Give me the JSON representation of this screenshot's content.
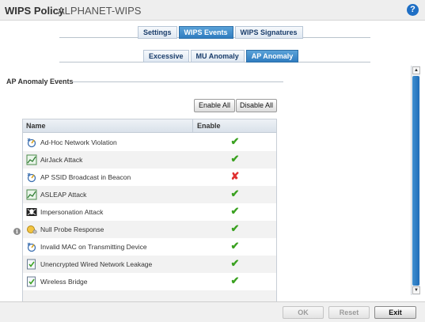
{
  "header": {
    "title": "WIPS Policy",
    "subtitle": "ALPHANET-WIPS",
    "help_icon": "help-icon"
  },
  "tabs_main": [
    {
      "label": "Settings",
      "active": false
    },
    {
      "label": "WIPS Events",
      "active": true
    },
    {
      "label": "WIPS Signatures",
      "active": false
    }
  ],
  "tabs_sub": [
    {
      "label": "Excessive",
      "active": false
    },
    {
      "label": "MU Anomaly",
      "active": false
    },
    {
      "label": "AP Anomaly",
      "active": true
    }
  ],
  "section": {
    "title": "AP Anomaly Events"
  },
  "actions": {
    "enable_all": "Enable All",
    "disable_all": "Disable All"
  },
  "table": {
    "columns": [
      "Name",
      "Enable"
    ],
    "rows": [
      {
        "name": "Ad-Hoc Network Violation",
        "icon": "network-violation-icon",
        "enabled": "✔"
      },
      {
        "name": "AirJack Attack",
        "icon": "chart-icon",
        "enabled": "✔"
      },
      {
        "name": "AP SSID Broadcast in Beacon",
        "icon": "network-violation-icon",
        "enabled": "✘"
      },
      {
        "name": "ASLEAP Attack",
        "icon": "chart-icon",
        "enabled": "✔"
      },
      {
        "name": "Impersonation Attack",
        "icon": "skull-icon",
        "enabled": "✔"
      },
      {
        "name": "Null Probe Response",
        "icon": "probe-icon",
        "enabled": "✔"
      },
      {
        "name": "Invalid MAC on Transmitting Device",
        "icon": "network-violation-icon",
        "enabled": "✔"
      },
      {
        "name": "Unencrypted Wired Network Leakage",
        "icon": "document-check-icon",
        "enabled": "✔"
      },
      {
        "name": "Wireless Bridge",
        "icon": "document-check-icon",
        "enabled": "✔"
      }
    ]
  },
  "info_glyph": "i",
  "footer": {
    "ok": "OK",
    "reset": "Reset",
    "exit": "Exit"
  },
  "colors": {
    "accent": "#2f7cc0",
    "check": "#3aa120",
    "cross": "#e03030"
  }
}
